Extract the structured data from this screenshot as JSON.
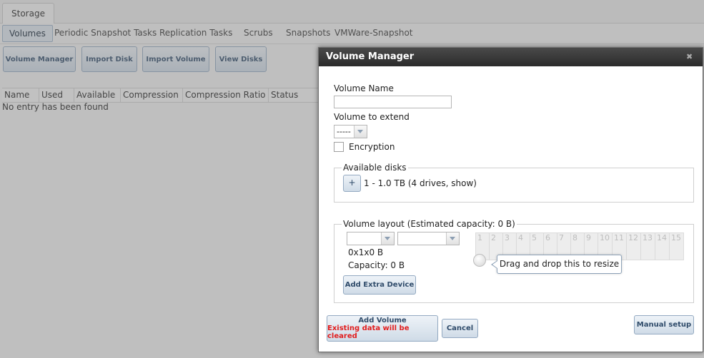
{
  "top_tab": "Storage",
  "subtabs": [
    "Volumes",
    "Periodic Snapshot Tasks",
    "Replication Tasks",
    "Scrubs",
    "Snapshots",
    "VMWare-Snapshot"
  ],
  "actions": [
    "Volume Manager",
    "Import Disk",
    "Import Volume",
    "View Disks"
  ],
  "table": {
    "columns": [
      "Name",
      "Used",
      "Available",
      "Compression",
      "Compression Ratio",
      "Status"
    ],
    "empty_text": "No entry has been found"
  },
  "dialog": {
    "title": "Volume Manager",
    "close_glyph": "✖",
    "volume_name_label": "Volume Name",
    "volume_name_value": "",
    "extend_label": "Volume to extend",
    "extend_value": "-----",
    "encryption_label": "Encryption",
    "available_disks": {
      "legend": "Available disks",
      "plus": "+",
      "disk_group": "1 - 1.0 TB (4 drives, show)"
    },
    "layout": {
      "legend": "Volume layout (Estimated capacity: 0 B)",
      "layout_value": "0x1x0 B",
      "capacity_text": "Capacity: 0 B",
      "extra_device_button": "Add Extra Device",
      "disk_numbers": [
        "1",
        "2",
        "3",
        "4",
        "5",
        "6",
        "7",
        "8",
        "9",
        "10",
        "11",
        "12",
        "13",
        "14",
        "15"
      ],
      "tooltip": "Drag and drop this to resize"
    },
    "buttons": {
      "add_volume": "Add Volume",
      "add_volume_warning": "Existing data will be cleared",
      "cancel": "Cancel",
      "manual_setup": "Manual setup"
    }
  },
  "colors": {
    "warning": "#e21c1c",
    "title_bar": "#333333",
    "button_text": "#2f4b6a"
  }
}
